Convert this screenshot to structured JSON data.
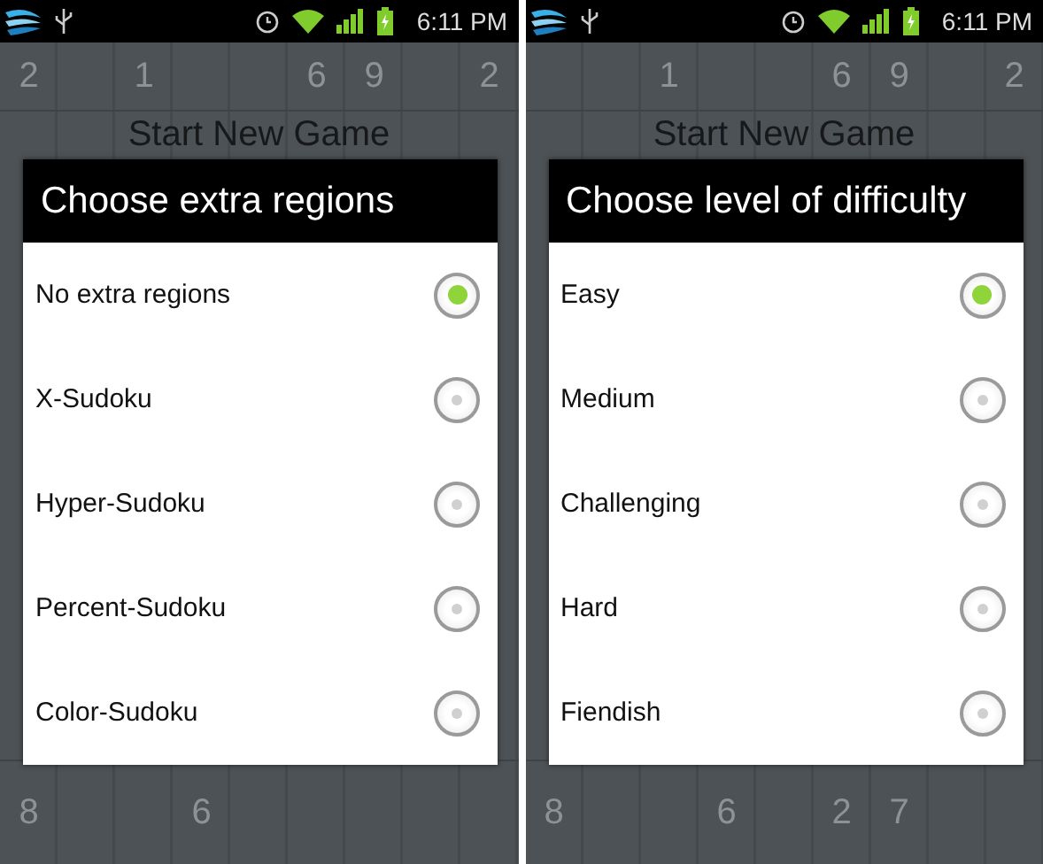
{
  "screens": [
    {
      "status_bar": {
        "time": "6:11 PM"
      },
      "background": {
        "top_row": [
          "2",
          "1",
          "6",
          "9",
          "2"
        ],
        "heading": "Start New Game",
        "bottom_row": [
          "8",
          "6"
        ]
      },
      "dialog": {
        "title": "Choose extra regions",
        "options": [
          {
            "label": "No extra regions",
            "selected": true
          },
          {
            "label": "X-Sudoku",
            "selected": false
          },
          {
            "label": "Hyper-Sudoku",
            "selected": false
          },
          {
            "label": "Percent-Sudoku",
            "selected": false
          },
          {
            "label": "Color-Sudoku",
            "selected": false
          }
        ]
      }
    },
    {
      "status_bar": {
        "time": "6:11 PM"
      },
      "background": {
        "top_row": [
          "1",
          "6",
          "9",
          "2"
        ],
        "heading": "Start New Game",
        "bottom_row": [
          "8",
          "6",
          "2",
          "7"
        ]
      },
      "dialog": {
        "title": "Choose level of difficulty",
        "options": [
          {
            "label": "Easy",
            "selected": true
          },
          {
            "label": "Medium",
            "selected": false
          },
          {
            "label": "Challenging",
            "selected": false
          },
          {
            "label": "Hard",
            "selected": false
          },
          {
            "label": "Fiendish",
            "selected": false
          }
        ]
      }
    }
  ]
}
